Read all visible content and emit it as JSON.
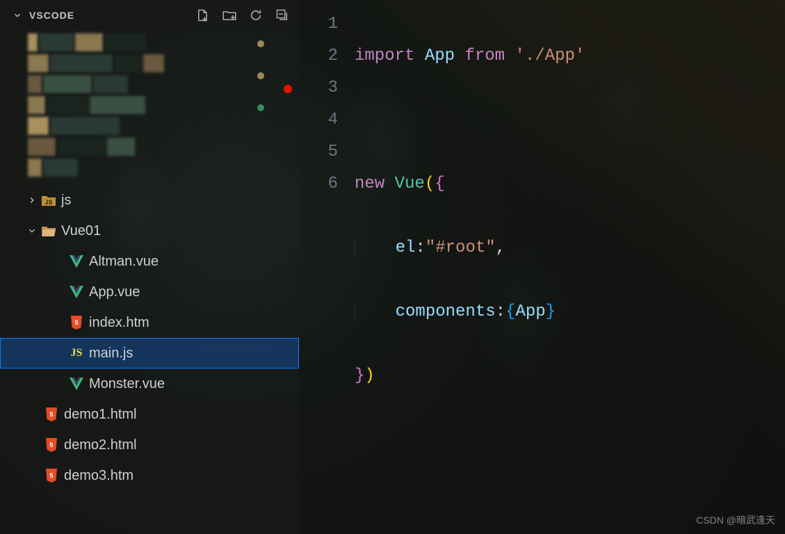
{
  "sidebar": {
    "title": "VSCODE",
    "tree": {
      "js": {
        "label": "js"
      },
      "vue01": {
        "label": "Vue01"
      },
      "files": [
        {
          "label": "Altman.vue",
          "type": "vue"
        },
        {
          "label": "App.vue",
          "type": "vue"
        },
        {
          "label": "index.htm",
          "type": "html"
        },
        {
          "label": "main.js",
          "type": "js",
          "selected": true
        },
        {
          "label": "Monster.vue",
          "type": "vue"
        }
      ],
      "root_files": [
        {
          "label": "demo1.html",
          "type": "html"
        },
        {
          "label": "demo2.html",
          "type": "html"
        },
        {
          "label": "demo3.htm",
          "type": "html"
        }
      ]
    }
  },
  "editor": {
    "lines": [
      {
        "n": "1"
      },
      {
        "n": "2"
      },
      {
        "n": "3"
      },
      {
        "n": "4"
      },
      {
        "n": "5"
      },
      {
        "n": "6"
      }
    ],
    "code": {
      "l1_import": "import",
      "l1_app": "App",
      "l1_from": "from",
      "l1_path": "'./App'",
      "l3_new": "new",
      "l3_vue": "Vue",
      "l4_el": "el",
      "l4_root": "\"#root\"",
      "l5_components": "components",
      "l5_app": "App"
    }
  },
  "watermark": "CSDN @暗武逢天"
}
